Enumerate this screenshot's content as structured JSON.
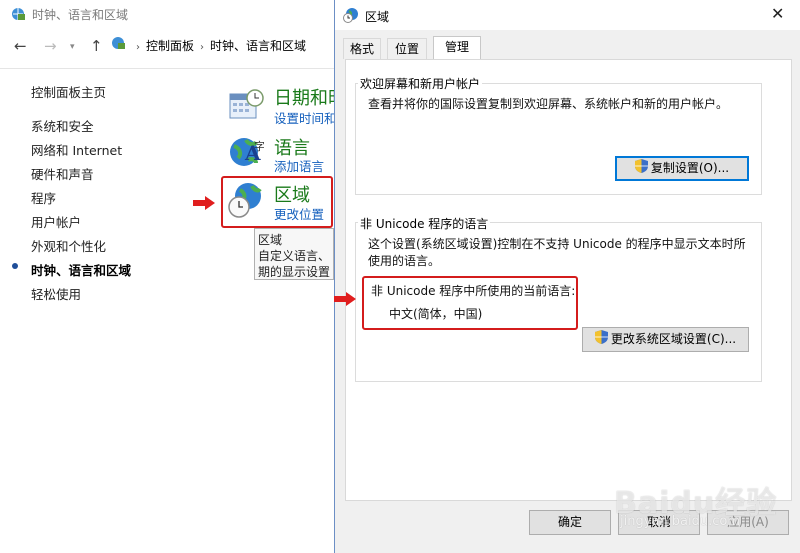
{
  "cp": {
    "title": "时钟、语言和区域",
    "breadcrumb": [
      "控制面板",
      "时钟、语言和区域"
    ],
    "sidebar": {
      "items": [
        {
          "label": "控制面板主页"
        },
        {
          "label": "系统和安全"
        },
        {
          "label": "网络和 Internet"
        },
        {
          "label": "硬件和声音"
        },
        {
          "label": "程序"
        },
        {
          "label": "用户帐户"
        },
        {
          "label": "外观和个性化"
        },
        {
          "label": "时钟、语言和区域",
          "active": true
        },
        {
          "label": "轻松使用"
        }
      ]
    },
    "categories": {
      "datetime": {
        "title": "日期和时",
        "link": "设置时间和"
      },
      "language": {
        "title": "语言",
        "link": "添加语言"
      },
      "region": {
        "title": "区域",
        "link": "更改位置"
      }
    },
    "tooltip": [
      "区域",
      "自定义语言、",
      "期的显示设置"
    ]
  },
  "dialog": {
    "title": "区域",
    "tabs": [
      "格式",
      "位置",
      "管理"
    ],
    "active_tab": "管理",
    "welcome": {
      "label": "欢迎屏幕和新用户帐户",
      "text": "查看并将你的国际设置复制到欢迎屏幕、系统帐户和新的用户帐户。",
      "button": "复制设置(O)..."
    },
    "unicode": {
      "label": "非 Unicode 程序的语言",
      "text": "这个设置(系统区域设置)控制在不支持 Unicode 的程序中显示文本时所使用的语言。",
      "current_label": "非 Unicode 程序中所使用的当前语言:",
      "current_value": "中文(简体，中国)",
      "button": "更改系统区域设置(C)..."
    },
    "buttons": {
      "ok": "确定",
      "cancel": "取消",
      "apply": "应用(A)"
    }
  },
  "watermark": {
    "brand": "Baidu经验",
    "url": "jingyan.baidu.com"
  },
  "colors": {
    "highlight": "#d41c1c",
    "link": "#1560bd",
    "category": "#1a7a1a"
  }
}
